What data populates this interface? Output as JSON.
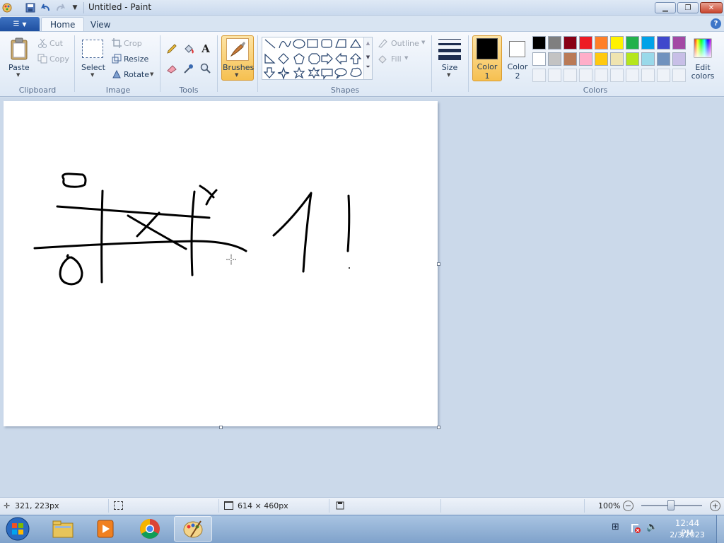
{
  "window": {
    "title": "Untitled - Paint"
  },
  "tabs": {
    "file_icon": "menu-icon",
    "home": "Home",
    "view": "View"
  },
  "clipboard": {
    "paste": "Paste",
    "cut": "Cut",
    "copy": "Copy",
    "group": "Clipboard"
  },
  "image": {
    "select": "Select",
    "crop": "Crop",
    "resize": "Resize",
    "rotate": "Rotate",
    "group": "Image"
  },
  "tools": {
    "group": "Tools"
  },
  "brushes": {
    "label": "Brushes"
  },
  "shapes": {
    "outline": "Outline",
    "fill": "Fill",
    "group": "Shapes"
  },
  "size": {
    "label": "Size"
  },
  "colors": {
    "color1": "Color",
    "color1_num": "1",
    "color2": "Color",
    "color2_num": "2",
    "edit": "Edit",
    "edit2": "colors",
    "group": "Colors",
    "color1_value": "#000000",
    "color2_value": "#ffffff",
    "palette_row1": [
      "#000000",
      "#7f7f7f",
      "#880015",
      "#ed1c24",
      "#ff7f27",
      "#fff200",
      "#22b14c",
      "#00a2e8",
      "#3f48cc",
      "#a349a4"
    ],
    "palette_row2": [
      "#ffffff",
      "#c3c3c3",
      "#b97a57",
      "#ffaec9",
      "#ffc90e",
      "#efe4b0",
      "#b5e61d",
      "#99d9ea",
      "#7092be",
      "#c8bfe7"
    ]
  },
  "status": {
    "cursor": "321, 223px",
    "canvas_size": "614 × 460px",
    "zoom": "100%",
    "zoom_level": 1.0
  },
  "clock": {
    "time": "12:44 PM",
    "date": "2/3/2023"
  }
}
